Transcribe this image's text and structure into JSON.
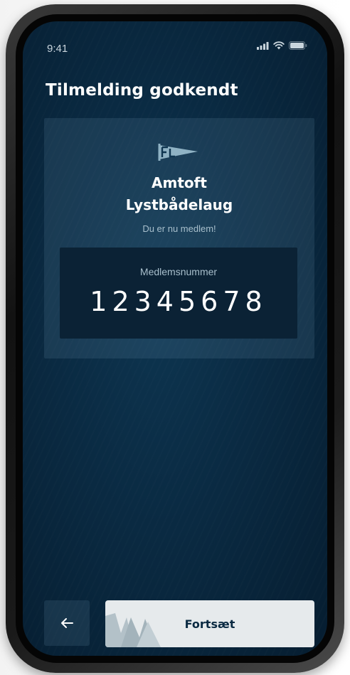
{
  "status_bar": {
    "time": "9:41"
  },
  "header": {
    "title": "Tilmelding godkendt"
  },
  "club": {
    "logo_icon": "pennant-flag-icon",
    "name_line1": "Amtoft",
    "name_line2": "Lystbådelaug",
    "status_text": "Du er nu medlem!"
  },
  "membership": {
    "label": "Medlemsnummer",
    "number": "12345678"
  },
  "footer": {
    "back_icon": "arrow-left-icon",
    "continue_label": "Fortsæt"
  },
  "colors": {
    "background": "#0a2a42",
    "card": "#1e4560",
    "member_box": "#0b2235",
    "button_light": "#e6eaec",
    "text_primary": "#ffffff",
    "text_muted": "#a8bfcc"
  }
}
